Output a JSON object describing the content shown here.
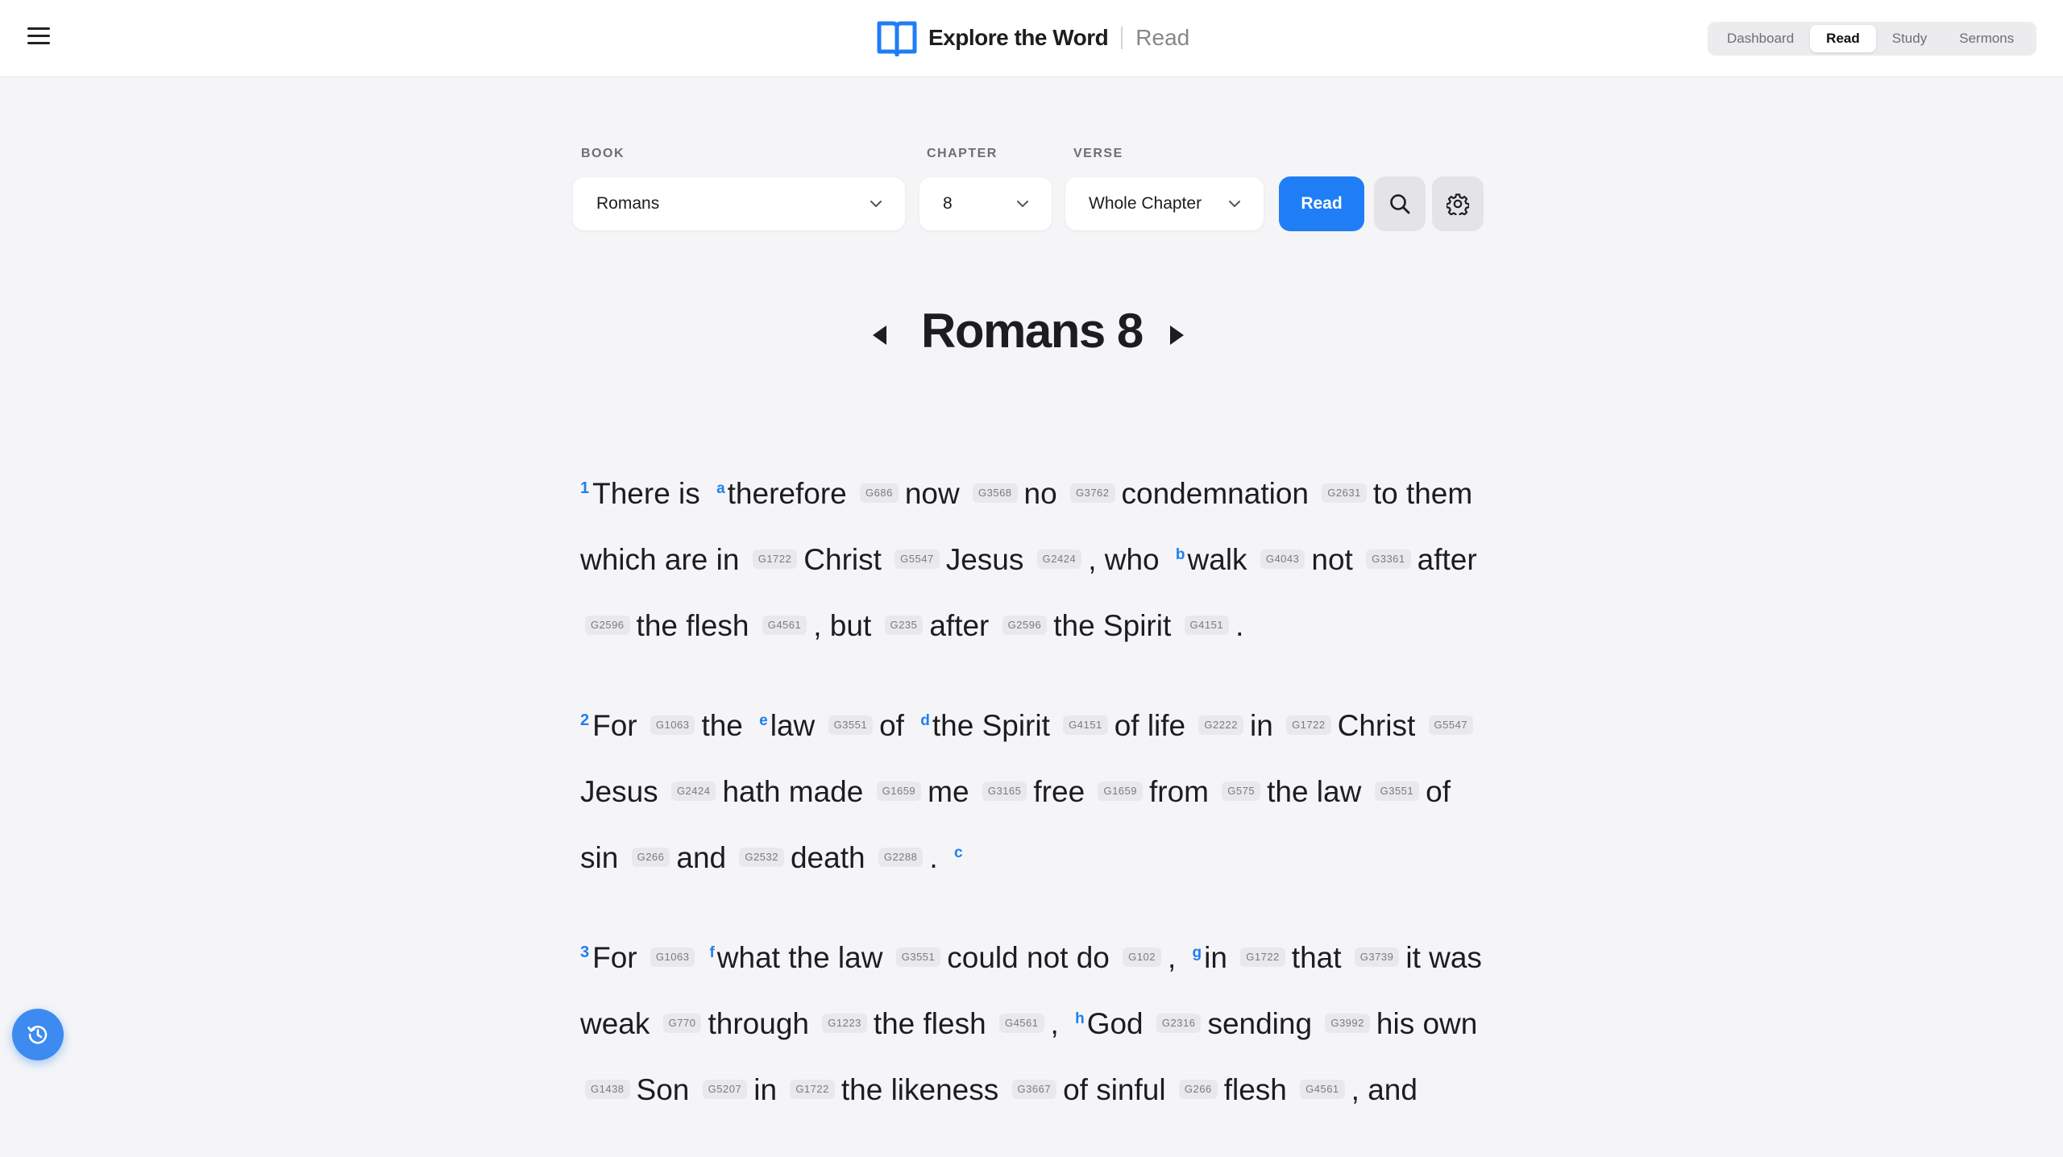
{
  "header": {
    "brand_name": "Explore the Word",
    "section": "Read",
    "nav": [
      {
        "label": "Dashboard",
        "active": false
      },
      {
        "label": "Read",
        "active": true
      },
      {
        "label": "Study",
        "active": false
      },
      {
        "label": "Sermons",
        "active": false
      }
    ]
  },
  "selector": {
    "book_label": "BOOK",
    "book_value": "Romans",
    "chapter_label": "CHAPTER",
    "chapter_value": "8",
    "verse_label": "VERSE",
    "verse_value": "Whole Chapter",
    "read_button": "Read"
  },
  "chapter_title": "Romans 8",
  "colors": {
    "accent": "#1f7ef5",
    "background": "#f5f5f7"
  },
  "verses": [
    {
      "number": "1",
      "tokens": [
        {
          "t": "There is"
        },
        {
          "f": "a"
        },
        {
          "t": "therefore"
        },
        {
          "s": "G686"
        },
        {
          "t": "now"
        },
        {
          "s": "G3568"
        },
        {
          "t": "no"
        },
        {
          "s": "G3762"
        },
        {
          "t": "condemnation"
        },
        {
          "s": "G2631"
        },
        {
          "t": "to them which are in"
        },
        {
          "s": "G1722"
        },
        {
          "t": "Christ"
        },
        {
          "s": "G5547"
        },
        {
          "t": "Jesus"
        },
        {
          "s": "G2424"
        },
        {
          "t": ", who"
        },
        {
          "f": "b"
        },
        {
          "t": "walk"
        },
        {
          "s": "G4043"
        },
        {
          "t": "not"
        },
        {
          "s": "G3361"
        },
        {
          "t": "after"
        },
        {
          "s": "G2596"
        },
        {
          "t": "the flesh"
        },
        {
          "s": "G4561"
        },
        {
          "t": ", but"
        },
        {
          "s": "G235"
        },
        {
          "t": "after"
        },
        {
          "s": "G2596"
        },
        {
          "t": "the Spirit"
        },
        {
          "s": "G4151"
        },
        {
          "t": "."
        }
      ]
    },
    {
      "number": "2",
      "tokens": [
        {
          "t": "For"
        },
        {
          "s": "G1063"
        },
        {
          "t": "the"
        },
        {
          "f": "e"
        },
        {
          "t": "law"
        },
        {
          "s": "G3551"
        },
        {
          "t": "of"
        },
        {
          "f": "d"
        },
        {
          "t": "the Spirit"
        },
        {
          "s": "G4151"
        },
        {
          "t": "of life"
        },
        {
          "s": "G2222"
        },
        {
          "t": "in"
        },
        {
          "s": "G1722"
        },
        {
          "t": "Christ"
        },
        {
          "s": "G5547"
        },
        {
          "t": "Jesus"
        },
        {
          "s": "G2424"
        },
        {
          "t": "hath made"
        },
        {
          "s": "G1659"
        },
        {
          "t": "me"
        },
        {
          "s": "G3165"
        },
        {
          "t": "free"
        },
        {
          "s": "G1659"
        },
        {
          "t": "from"
        },
        {
          "s": "G575"
        },
        {
          "t": "the law"
        },
        {
          "s": "G3551"
        },
        {
          "t": "of sin"
        },
        {
          "s": "G266"
        },
        {
          "t": "and"
        },
        {
          "s": "G2532"
        },
        {
          "t": "death"
        },
        {
          "s": "G2288"
        },
        {
          "t": "."
        },
        {
          "f": "c"
        }
      ]
    },
    {
      "number": "3",
      "tokens": [
        {
          "t": "For"
        },
        {
          "s": "G1063"
        },
        {
          "f": "f"
        },
        {
          "t": "what the law"
        },
        {
          "s": "G3551"
        },
        {
          "t": "could not do"
        },
        {
          "s": "G102"
        },
        {
          "t": ","
        },
        {
          "f": "g"
        },
        {
          "t": "in"
        },
        {
          "s": "G1722"
        },
        {
          "t": "that"
        },
        {
          "s": "G3739"
        },
        {
          "t": "it was weak"
        },
        {
          "s": "G770"
        },
        {
          "t": "through"
        },
        {
          "s": "G1223"
        },
        {
          "t": "the flesh"
        },
        {
          "s": "G4561"
        },
        {
          "t": ","
        },
        {
          "f": "h"
        },
        {
          "t": "God"
        },
        {
          "s": "G2316"
        },
        {
          "t": "sending"
        },
        {
          "s": "G3992"
        },
        {
          "t": "his own"
        },
        {
          "s": "G1438"
        },
        {
          "t": "Son"
        },
        {
          "s": "G5207"
        },
        {
          "t": "in"
        },
        {
          "s": "G1722"
        },
        {
          "t": "the likeness"
        },
        {
          "s": "G3667"
        },
        {
          "t": "of sinful"
        },
        {
          "s": "G266"
        },
        {
          "t": "flesh"
        },
        {
          "s": "G4561"
        },
        {
          "t": ", and"
        }
      ]
    }
  ]
}
